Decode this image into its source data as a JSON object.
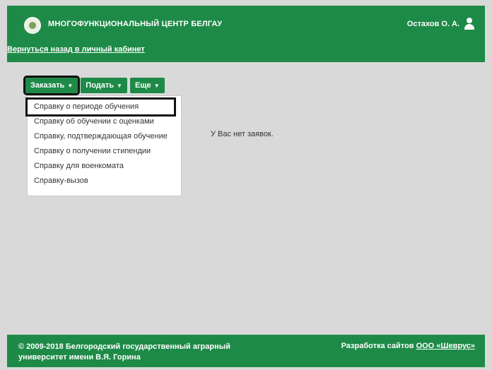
{
  "header": {
    "brand": "МНОГОФУНКЦИОНАЛЬНЫЙ ЦЕНТР БЕЛГАУ",
    "back_link": "Вернуться назад в личный кабинет",
    "user_name": "Остахов О. А."
  },
  "toolbar": {
    "order_label": "Заказать",
    "submit_label": "Подать",
    "more_label": "Еще"
  },
  "dropdown": {
    "items": [
      "Справку о периоде обучения",
      "Справку об обучении с оценками",
      "Справку, подтверждающая обучение",
      "Справку о получении стипендии",
      "Справку для военкомата",
      "Справку-вызов"
    ]
  },
  "main": {
    "empty_text": "У Вас нет заявок."
  },
  "footer": {
    "copyright_line1": "© 2009-2018 Белгородский государственный аграрный",
    "copyright_line2": "университет имени В.Я. Горина",
    "dev_prefix": "Разработка сайтов",
    "dev_link": "ООО «Шеврус»"
  },
  "colors": {
    "brand_green": "#1e8a47",
    "page_bg": "#d9d9d9"
  },
  "icons": [
    "university-logo-icon",
    "user-icon",
    "caret-down-icon"
  ]
}
